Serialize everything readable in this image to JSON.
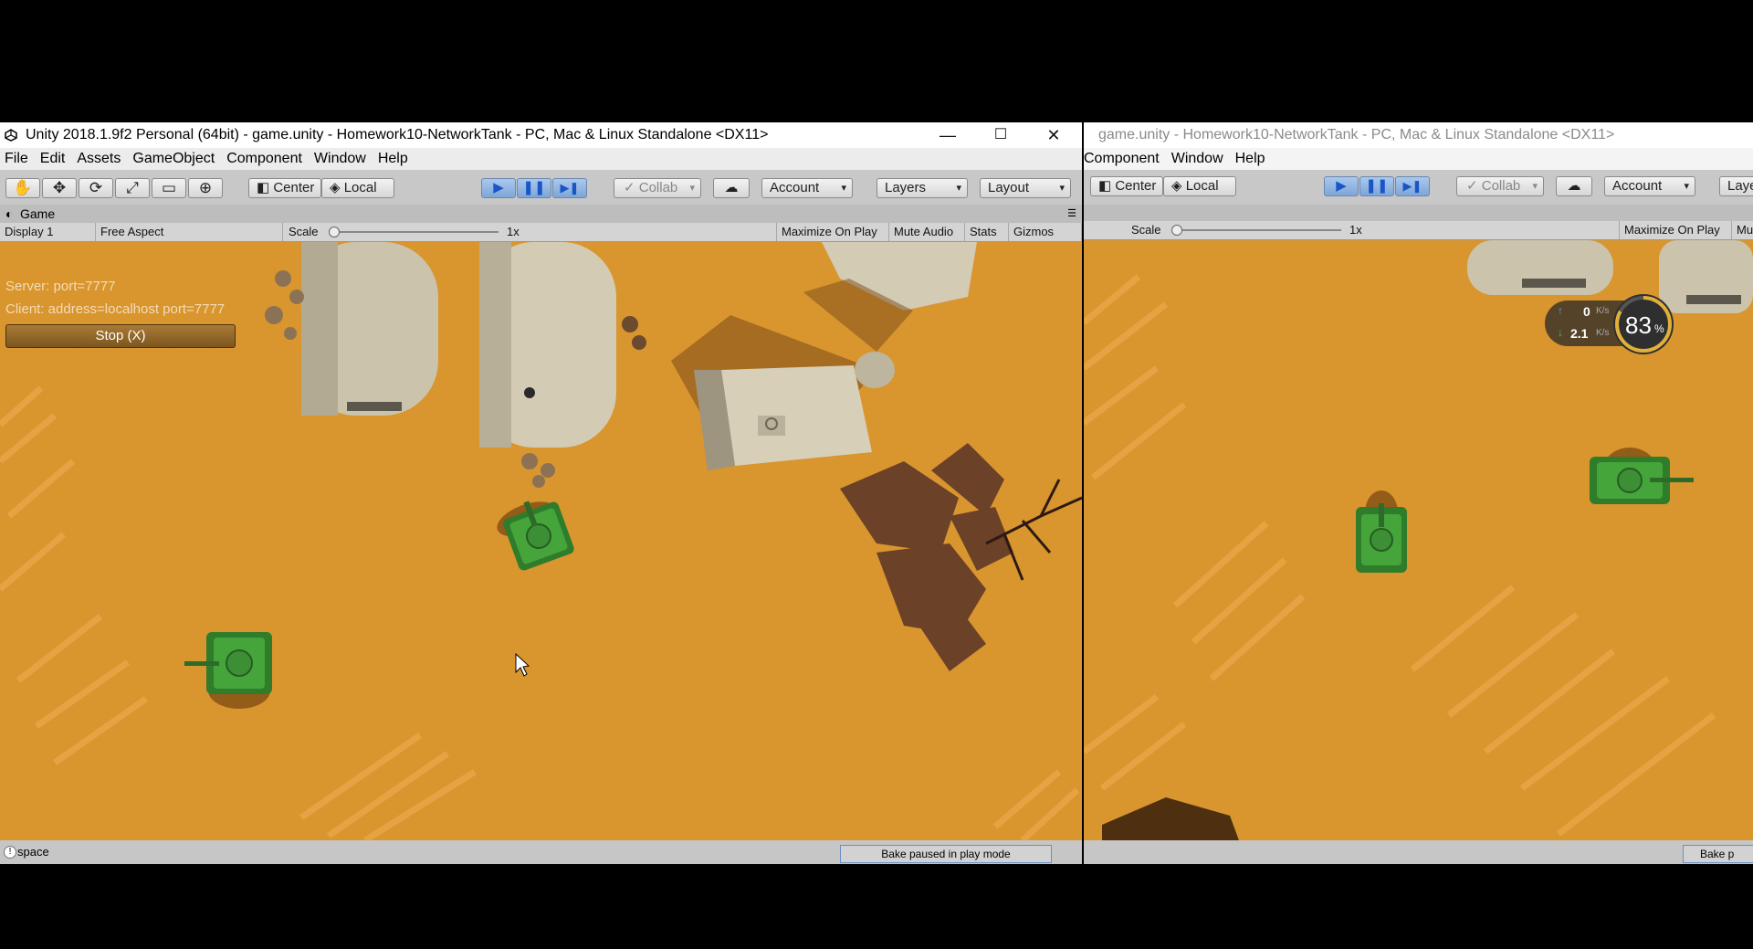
{
  "window_left": {
    "title": "Unity 2018.1.9f2 Personal (64bit) - game.unity - Homework10-NetworkTank - PC, Mac & Linux Standalone <DX11>",
    "controls": {
      "minimize": "—",
      "maximize": "☐",
      "close": "✕"
    },
    "menu": [
      "File",
      "Edit",
      "Assets",
      "GameObject",
      "Component",
      "Window",
      "Help"
    ],
    "toolbar": {
      "tools": [
        "✋",
        "✥",
        "⟳",
        "⤢",
        "▭",
        "⊕"
      ],
      "pivot": "Center",
      "space": "Local",
      "play": "▶",
      "pause": "❚❚",
      "step": "▶❚",
      "collab": "Collab",
      "cloud": "☁",
      "account": "Account",
      "layers": "Layers",
      "layout": "Layout"
    },
    "tab": {
      "icon": "◐",
      "label": "Game",
      "menu_icon": "☰"
    },
    "game_bar": {
      "display": "Display 1",
      "aspect": "Free Aspect",
      "scale_label": "Scale",
      "scale_value": "1x",
      "maximize": "Maximize On Play",
      "mute": "Mute Audio",
      "stats": "Stats",
      "gizmos": "Gizmos"
    },
    "network_hud": {
      "server": "Server: port=7777",
      "client": "Client: address=localhost port=7777",
      "stop_button": "Stop (X)"
    },
    "status": {
      "icon": "!",
      "message": "space",
      "bake": "Bake paused in play mode"
    }
  },
  "window_right": {
    "title": "game.unity - Homework10-NetworkTank - PC, Mac & Linux Standalone <DX11>",
    "menu": [
      "Component",
      "Window",
      "Help"
    ],
    "toolbar": {
      "pivot": "Center",
      "space": "Local",
      "play": "▶",
      "pause": "❚❚",
      "step": "▶❚",
      "collab": "Collab",
      "cloud": "☁",
      "account": "Account",
      "layers_partial": "Laye"
    },
    "game_bar": {
      "scale_label": "Scale",
      "scale_value": "1x",
      "maximize": "Maximize On Play",
      "mute_partial": "Mu"
    },
    "net_monitor": {
      "upload": "0",
      "upload_unit": "K/s",
      "download": "2.1",
      "download_unit": "K/s",
      "percent": "83",
      "percent_unit": "%",
      "percent_value": 0.83
    },
    "status": {
      "bake_partial": "Bake p"
    }
  },
  "colors": {
    "sand": "#d9952e",
    "tank": "#3a8a36",
    "building": "#c9bfa6",
    "toolbar": "#c8c8c8",
    "play_active": "#1a55c7"
  }
}
